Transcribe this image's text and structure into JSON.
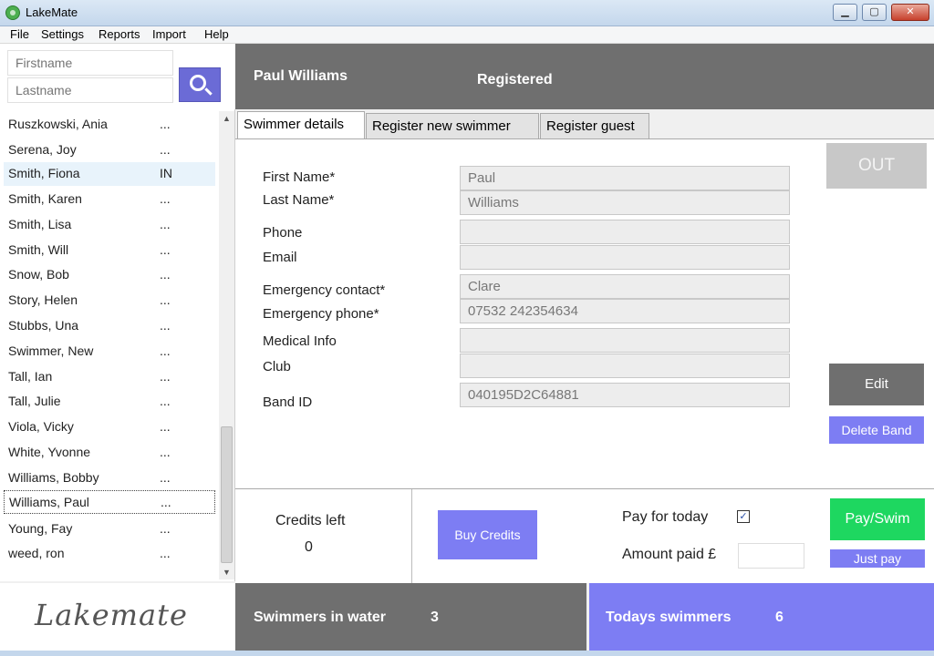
{
  "window": {
    "title": "LakeMate",
    "min_label": "▁",
    "max_label": "▢",
    "close_label": "✕"
  },
  "menu": [
    "File",
    "Settings",
    "Reports",
    "Import",
    "Help"
  ],
  "search": {
    "firstname_placeholder": "Firstname",
    "lastname_placeholder": "Lastname"
  },
  "swimmers": [
    {
      "name": "Ruszkowski, Ania",
      "status": "..."
    },
    {
      "name": "Serena, Joy",
      "status": "..."
    },
    {
      "name": "Smith, Fiona",
      "status": "IN"
    },
    {
      "name": "Smith, Karen",
      "status": "..."
    },
    {
      "name": "Smith, Lisa",
      "status": "..."
    },
    {
      "name": "Smith, Will",
      "status": "..."
    },
    {
      "name": "Snow, Bob",
      "status": "..."
    },
    {
      "name": "Story, Helen",
      "status": "..."
    },
    {
      "name": "Stubbs, Una",
      "status": "..."
    },
    {
      "name": "Swimmer, New",
      "status": "..."
    },
    {
      "name": "Tall, Ian",
      "status": "..."
    },
    {
      "name": "Tall, Julie",
      "status": "..."
    },
    {
      "name": "Viola, Vicky",
      "status": "..."
    },
    {
      "name": "White, Yvonne",
      "status": "..."
    },
    {
      "name": "Williams, Bobby",
      "status": "..."
    },
    {
      "name": "Williams, Paul",
      "status": "..."
    },
    {
      "name": "Young, Fay",
      "status": "..."
    },
    {
      "name": "weed, ron",
      "status": "..."
    }
  ],
  "header": {
    "name": "Paul Williams",
    "status": "Registered"
  },
  "tabs": [
    "Swimmer details",
    "Register new swimmer",
    "Register guest"
  ],
  "details": {
    "labels": {
      "first_name": "First Name*",
      "last_name": "Last Name*",
      "phone": "Phone",
      "email": "Email",
      "emergency_contact": "Emergency contact*",
      "emergency_phone": "Emergency phone*",
      "medical_info": "Medical Info",
      "club": "Club",
      "band_id": "Band ID"
    },
    "values": {
      "first_name": "Paul",
      "last_name": "Williams",
      "phone": "",
      "email": "",
      "emergency_contact": "Clare",
      "emergency_phone": "07532 242354634",
      "medical_info": "",
      "club": "",
      "band_id": "040195D2C64881"
    },
    "out_label": "OUT",
    "edit_label": "Edit",
    "delete_band_label": "Delete Band"
  },
  "payment": {
    "credits_label": "Credits left",
    "credits_value": "0",
    "buy_label": "Buy Credits",
    "pay_for_today_label": "Pay for today",
    "pay_for_today_checked": true,
    "check_mark": "✓",
    "amount_label": "Amount paid £",
    "amount_value": "",
    "pay_swim_label": "Pay/Swim",
    "just_pay_label": "Just pay"
  },
  "footer": {
    "logo": "Lakemate",
    "in_water_label": "Swimmers in water",
    "in_water_value": "3",
    "today_label": "Todays swimmers",
    "today_value": "6"
  },
  "colors": {
    "accent": "#7d7df3",
    "header": "#6f6f6f",
    "go": "#1ed760"
  }
}
